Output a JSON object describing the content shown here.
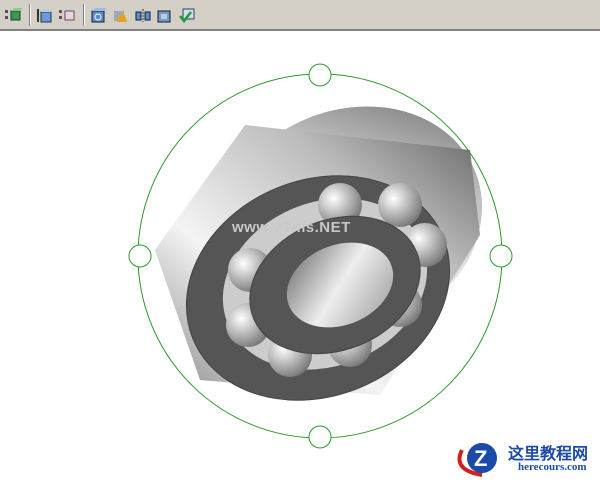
{
  "toolbar": {
    "buttons": [
      {
        "name": "view-select-icon"
      },
      {
        "sep": true
      },
      {
        "name": "front-view-icon"
      },
      {
        "name": "hidden-lines-icon"
      },
      {
        "sep": true
      },
      {
        "name": "rotate-view-icon"
      },
      {
        "name": "clean-icon"
      },
      {
        "name": "section-view-icon"
      },
      {
        "name": "shaded-view-icon"
      },
      {
        "name": "accept-view-icon"
      }
    ]
  },
  "watermark": "www.??ms.NET",
  "logo": {
    "cn": "这里教程网",
    "en": "herecours.com",
    "letter": "Z"
  },
  "colors": {
    "handle": "#2a9a2a",
    "toolbar": "#d4d0c8"
  }
}
